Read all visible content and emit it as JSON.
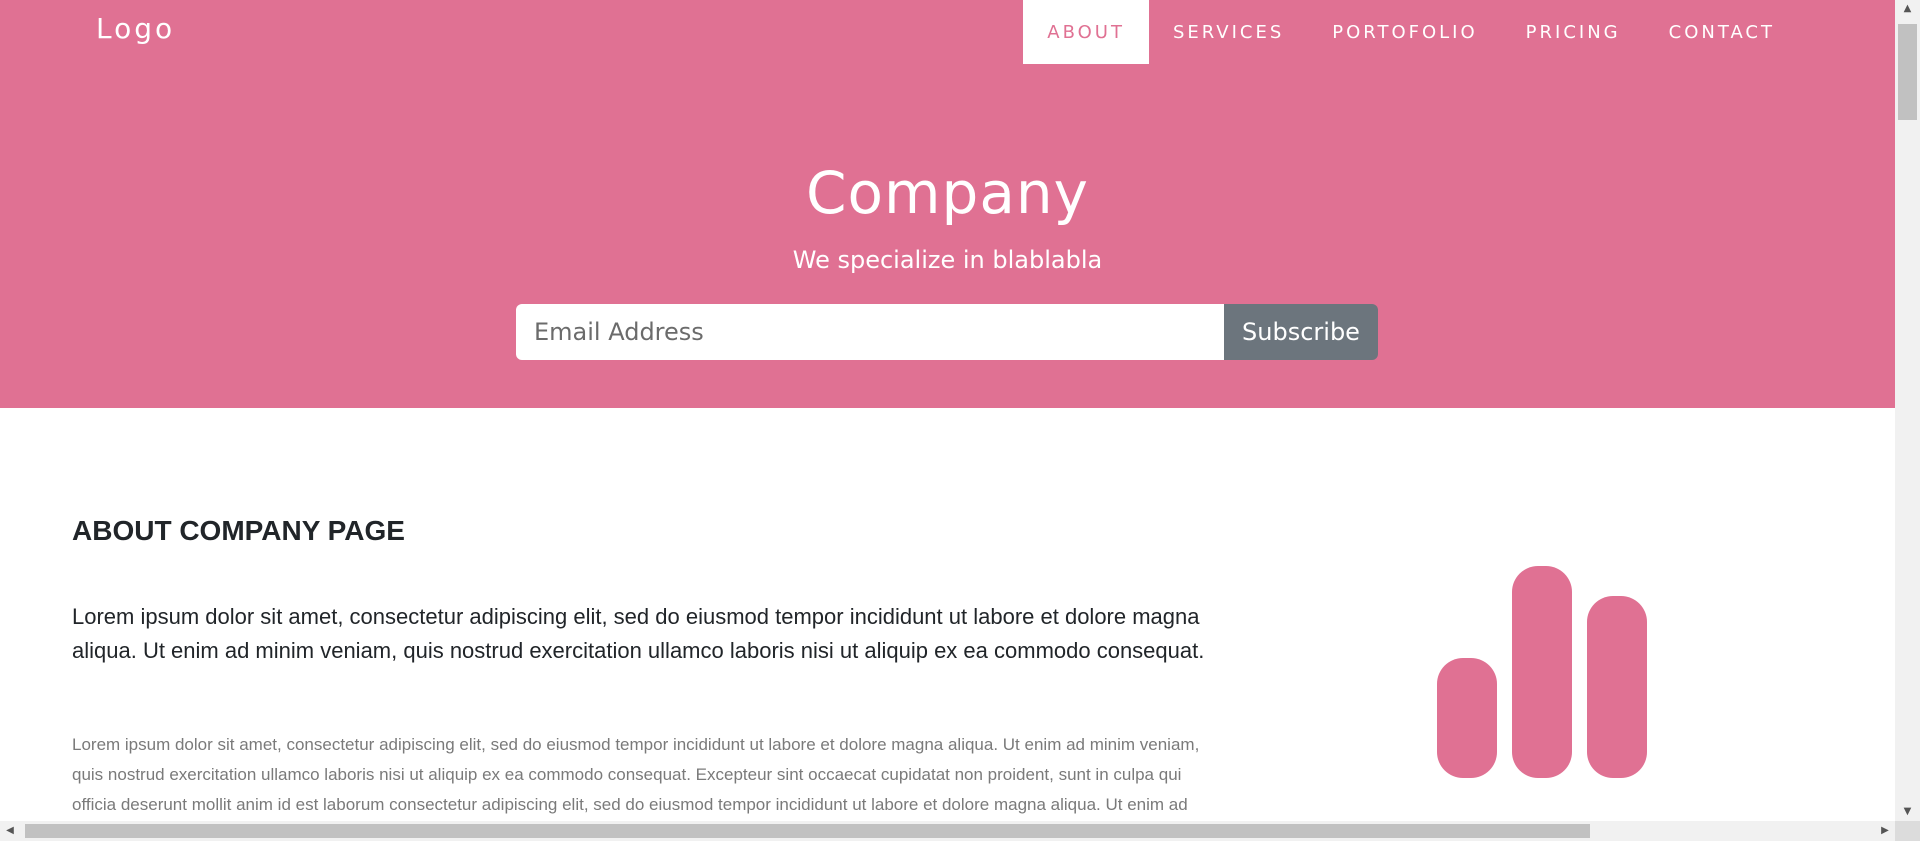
{
  "navbar": {
    "logo": "Logo",
    "items": [
      {
        "label": "ABOUT",
        "active": true
      },
      {
        "label": "SERVICES",
        "active": false
      },
      {
        "label": "PORTOFOLIO",
        "active": false
      },
      {
        "label": "PRICING",
        "active": false
      },
      {
        "label": "CONTACT",
        "active": false
      }
    ]
  },
  "hero": {
    "title": "Company",
    "subtitle": "We specialize in blablabla",
    "email_placeholder": "Email Address",
    "subscribe_label": "Subscribe"
  },
  "about": {
    "title": "ABOUT COMPANY PAGE",
    "lead": "Lorem ipsum dolor sit amet, consectetur adipiscing elit, sed do eiusmod tempor incididunt ut labore et dolore magna aliqua. Ut enim ad minim veniam, quis nostrud exercitation ullamco laboris nisi ut aliquip ex ea commodo consequat.",
    "body": "Lorem ipsum dolor sit amet, consectetur adipiscing elit, sed do eiusmod tempor incididunt ut labore et dolore magna aliqua. Ut enim ad minim veniam, quis nostrud exercitation ullamco laboris nisi ut aliquip ex ea commodo consequat. Excepteur sint occaecat cupidatat non proident, sunt in culpa qui officia deserunt mollit anim id est laborum consectetur adipiscing elit, sed do eiusmod tempor incididunt ut labore et dolore magna aliqua. Ut enim ad minim veniam, quis nostrud exercitation ullamco laboris nisi ut aliquip ex ea commodo consequat.",
    "icon": "signal-bars-icon"
  },
  "colors": {
    "brand": "#e07193",
    "button_gray": "#6c757d",
    "text_dark": "#212529",
    "text_muted": "#7a7a7a"
  }
}
